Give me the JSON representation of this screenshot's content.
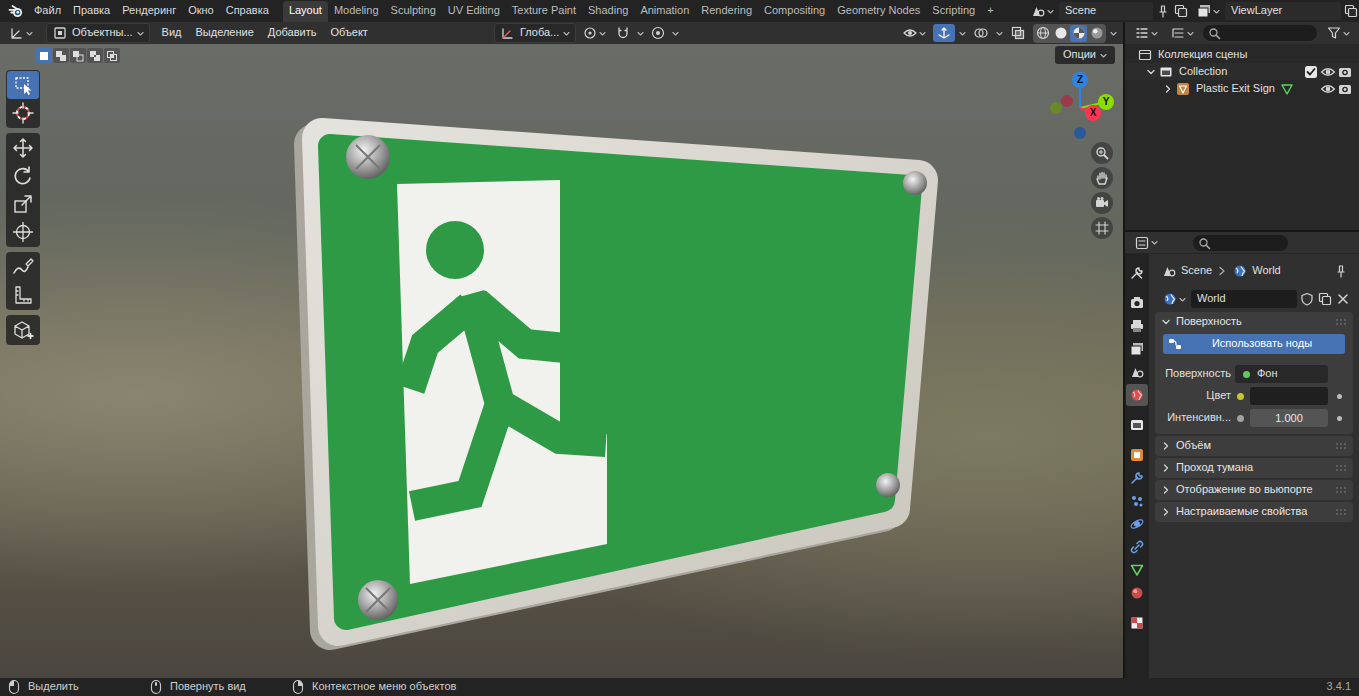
{
  "topbar": {
    "menus": [
      "Файл",
      "Правка",
      "Рендеринг",
      "Окно",
      "Справка"
    ],
    "workspaces": [
      {
        "label": "Layout",
        "selected": true
      },
      {
        "label": "Modeling",
        "selected": false
      },
      {
        "label": "Sculpting",
        "selected": false
      },
      {
        "label": "UV Editing",
        "selected": false
      },
      {
        "label": "Texture Paint",
        "selected": false
      },
      {
        "label": "Shading",
        "selected": false
      },
      {
        "label": "Animation",
        "selected": false
      },
      {
        "label": "Rendering",
        "selected": false
      },
      {
        "label": "Compositing",
        "selected": false
      },
      {
        "label": "Geometry Nodes",
        "selected": false
      },
      {
        "label": "Scripting",
        "selected": false
      }
    ],
    "add_tab": "+",
    "scene": "Scene",
    "view_layer": "ViewLayer"
  },
  "viewport": {
    "mode": "Объектны...",
    "menus": [
      "Вид",
      "Выделение",
      "Добавить",
      "Объект"
    ],
    "orientation": "Глоба...",
    "toggles": [
      {
        "kind": "snap",
        "on": false
      },
      {
        "kind": "proportional",
        "on": false
      },
      {
        "kind": "gizmos",
        "on": true
      },
      {
        "kind": "overlays",
        "on": false
      },
      {
        "kind": "xray",
        "on": false
      }
    ],
    "shading": [
      {
        "kind": "wireframe",
        "selected": false
      },
      {
        "kind": "solid",
        "selected": false
      },
      {
        "kind": "material",
        "selected": true
      },
      {
        "kind": "rendered",
        "selected": false
      }
    ],
    "select_modes": [
      {
        "kind": "new",
        "selected": true
      },
      {
        "kind": "extend",
        "selected": false
      },
      {
        "kind": "subtract",
        "selected": false
      },
      {
        "kind": "difference",
        "selected": false
      },
      {
        "kind": "intersect",
        "selected": false
      }
    ],
    "options": "Опции",
    "tools": [
      {
        "kind": "select-box",
        "selected": true
      },
      {
        "kind": "cursor",
        "selected": false
      },
      {
        "kind": "move",
        "selected": false
      },
      {
        "kind": "rotate",
        "selected": false
      },
      {
        "kind": "scale",
        "selected": false
      },
      {
        "kind": "transform",
        "selected": false
      },
      {
        "kind": "annotate",
        "selected": false
      },
      {
        "kind": "measure",
        "selected": false
      },
      {
        "kind": "add-cube",
        "selected": false
      }
    ],
    "gizmo": {
      "x": "X",
      "y": "Y",
      "z": "Z"
    }
  },
  "outliner": {
    "items": [
      {
        "label": "Коллекция сцены",
        "kind": "scene-collection"
      },
      {
        "label": "Collection",
        "kind": "collection",
        "expanded": true,
        "checked": true,
        "visible": true,
        "renderable": true
      },
      {
        "label": "Plastic Exit Sign",
        "kind": "object",
        "expanded": false,
        "visible": true,
        "renderable": true
      }
    ]
  },
  "properties": {
    "tabs": [
      {
        "kind": "tool",
        "selected": false
      },
      {
        "kind": "render",
        "selected": false
      },
      {
        "kind": "output",
        "selected": false
      },
      {
        "kind": "view-layer",
        "selected": false
      },
      {
        "kind": "scene",
        "selected": false
      },
      {
        "kind": "world",
        "selected": true
      },
      {
        "kind": "collection",
        "selected": false
      },
      {
        "kind": "object",
        "selected": false
      },
      {
        "kind": "modifiers",
        "selected": false
      },
      {
        "kind": "particles",
        "selected": false
      },
      {
        "kind": "physics",
        "selected": false
      },
      {
        "kind": "constraints",
        "selected": false
      },
      {
        "kind": "data",
        "selected": false
      },
      {
        "kind": "material",
        "selected": false
      },
      {
        "kind": "texture",
        "selected": false
      }
    ],
    "breadcrumb": [
      {
        "label": "Scene",
        "kind": "scene"
      },
      {
        "label": "World",
        "kind": "world"
      }
    ],
    "world": "World",
    "panels": [
      {
        "label": "Поверхность",
        "expanded": true,
        "button": "Использовать ноды",
        "fields": [
          {
            "label": "Поверхность",
            "value": "Фон",
            "kind": "shader"
          },
          {
            "label": "Цвет",
            "kind": "color"
          },
          {
            "label": "Интенсивн...",
            "value": "1.000",
            "kind": "number"
          }
        ]
      },
      {
        "label": "Объём",
        "expanded": false
      },
      {
        "label": "Проход тумана",
        "expanded": false
      },
      {
        "label": "Отображение во вьюпорте",
        "expanded": false
      },
      {
        "label": "Настраиваемые свойства",
        "expanded": false
      }
    ]
  },
  "status_bar": {
    "items": [
      {
        "label": "Выделить",
        "kind": "left"
      },
      {
        "label": "Повернуть вид",
        "kind": "middle"
      },
      {
        "label": "Контекстное меню объектов",
        "kind": "right"
      }
    ],
    "version": "3.4.1"
  }
}
